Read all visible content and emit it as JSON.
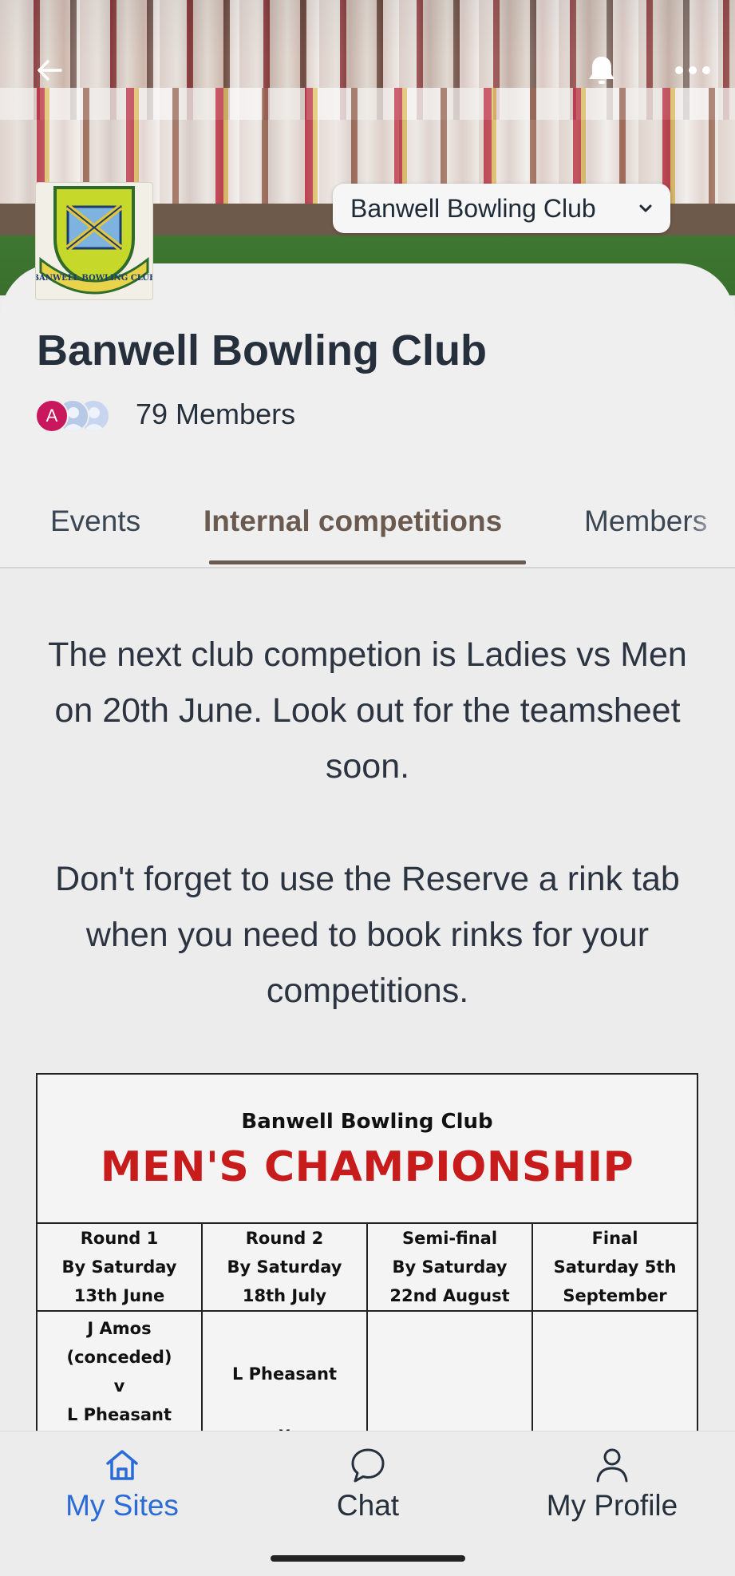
{
  "header": {
    "club_selector_label": "Banwell Bowling Club",
    "logo_text": "BANWELL BOWLING CLUB"
  },
  "profile": {
    "title": "Banwell Bowling Club",
    "avatar_initial": "A",
    "members_count": "79 Members"
  },
  "tabs": [
    {
      "label": "Events",
      "active": false
    },
    {
      "label": "Internal competitions",
      "active": true
    },
    {
      "label": "Members",
      "active": false
    }
  ],
  "content": {
    "paragraph_1": "The next club competion is Ladies vs Men on 20th June. Look out for the teamsheet soon.",
    "paragraph_2": "Don't forget to use the Reserve a rink tab when you need to book rinks for your competitions."
  },
  "sheet": {
    "club": "Banwell Bowling Club",
    "title": "MEN'S CHAMPIONSHIP",
    "headers": [
      {
        "line1": "Round 1",
        "line2": "By Saturday",
        "line3": "13th June"
      },
      {
        "line1": "Round 2",
        "line2": "By Saturday",
        "line3": "18th July"
      },
      {
        "line1": "Semi-final",
        "line2": "By Saturday",
        "line3": "22nd August"
      },
      {
        "line1": "Final",
        "line2": "Saturday 5th",
        "line3": "September"
      }
    ],
    "round1_match1": {
      "player1": "J Amos",
      "note": "(conceded)",
      "vs": "v",
      "player2": "L Pheasant"
    },
    "round2_player": "L Pheasant",
    "round2_vs": "v"
  },
  "bottom_nav": [
    {
      "label": "My Sites",
      "icon": "home-icon",
      "active": true
    },
    {
      "label": "Chat",
      "icon": "chat-bubble-icon",
      "active": false
    },
    {
      "label": "My Profile",
      "icon": "person-icon",
      "active": false
    }
  ],
  "colors": {
    "accent_blue": "#2a6bd6",
    "tab_active": "#6b5a4f",
    "sheet_title_red": "#c81c1c",
    "text_dark": "#26303c"
  }
}
